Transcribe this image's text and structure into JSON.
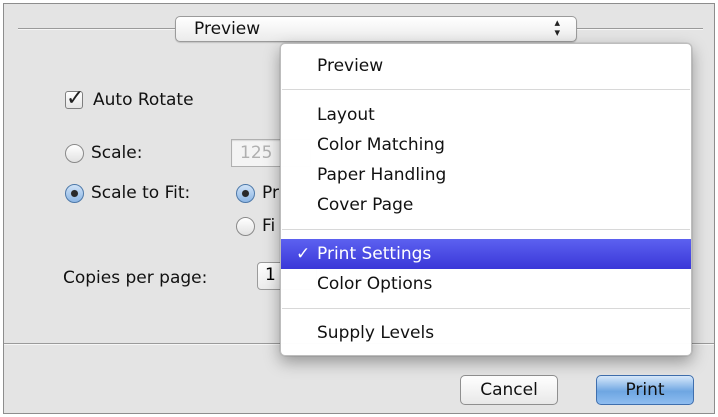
{
  "panel": {
    "popup": {
      "label": "Preview",
      "arrows_icon": "up-down-arrows-icon"
    },
    "auto_rotate": {
      "label": "Auto Rotate",
      "checked": true
    },
    "scale": {
      "label": "Scale:",
      "value": "125",
      "selected": false
    },
    "scale_to_fit": {
      "label": "Scale to Fit:",
      "selected": true,
      "options": [
        {
          "label": "Pr",
          "selected": true
        },
        {
          "label": "Fi",
          "selected": false
        }
      ]
    },
    "copies_per_page": {
      "label": "Copies per page:",
      "value": "1"
    }
  },
  "menu": {
    "items": [
      {
        "label": "Preview",
        "checked": false,
        "highlighted": false
      },
      {
        "label": "Layout",
        "checked": false,
        "highlighted": false
      },
      {
        "label": "Color Matching",
        "checked": false,
        "highlighted": false
      },
      {
        "label": "Paper Handling",
        "checked": false,
        "highlighted": false
      },
      {
        "label": "Cover Page",
        "checked": false,
        "highlighted": false
      },
      {
        "label": "Print Settings",
        "checked": true,
        "highlighted": true
      },
      {
        "label": "Color Options",
        "checked": false,
        "highlighted": false
      },
      {
        "label": "Supply Levels",
        "checked": false,
        "highlighted": false
      }
    ],
    "check_glyph": "✓"
  },
  "buttons": {
    "cancel": "Cancel",
    "print": "Print"
  },
  "colors": {
    "highlight": "#4648e6",
    "default_button": "#6ea6e2"
  }
}
